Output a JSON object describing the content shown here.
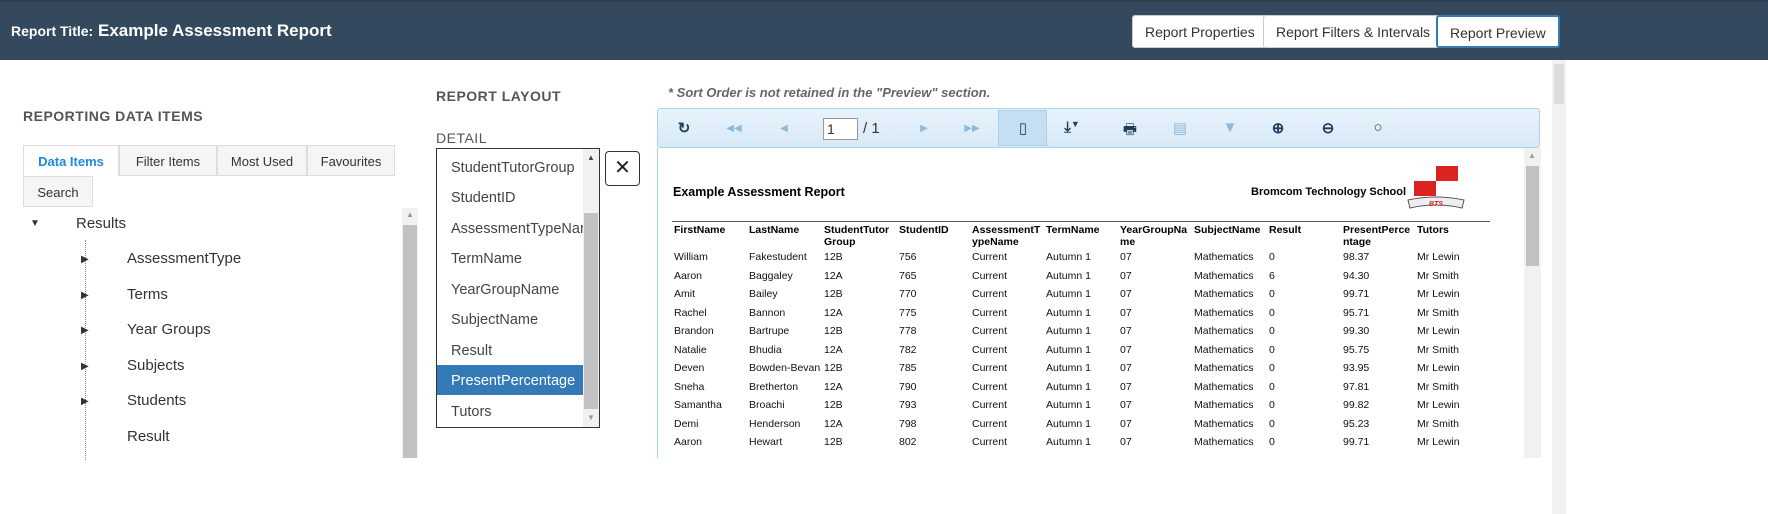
{
  "header": {
    "label": "Report Title:",
    "title": "Example Assessment Report",
    "buttons": [
      "Report Properties",
      "Report Filters & Intervals",
      "Report Preview"
    ]
  },
  "left": {
    "heading": "REPORTING DATA ITEMS",
    "tabs": [
      "Data Items",
      "Filter Items",
      "Most Used",
      "Favourites",
      "Search"
    ],
    "tree": {
      "root": "Results",
      "children": [
        "AssessmentType",
        "Terms",
        "Year Groups",
        "Subjects",
        "Students",
        "Result"
      ]
    }
  },
  "layout": {
    "heading": "REPORT LAYOUT",
    "detail": "DETAIL",
    "items": [
      "StudentTutorGroup",
      "StudentID",
      "AssessmentTypeName",
      "TermName",
      "YearGroupName",
      "SubjectName",
      "Result",
      "PresentPercentage",
      "Tutors"
    ],
    "selected": "PresentPercentage",
    "remove": "✕"
  },
  "preview": {
    "note": "* Sort Order is not retained in the \"Preview\" section.",
    "page": "1",
    "page_total": "/ 1",
    "toolbar_icons": [
      "refresh-icon",
      "first-page-icon",
      "prev-page-icon",
      "next-page-icon",
      "last-page-icon",
      "page-view-icon",
      "export-icon",
      "print-icon",
      "document-map-icon",
      "filter-icon",
      "zoom-in-icon",
      "zoom-out-icon",
      "zoom-icon"
    ]
  },
  "report": {
    "title": "Example Assessment Report",
    "school": "Bromcom Technology School",
    "logo_text": "BTS",
    "columns": [
      "FirstName",
      "LastName",
      "StudentTutor Group",
      "StudentID",
      "AssessmentT ypeName",
      "TermName",
      "YearGroupNa me",
      "SubjectName",
      "Result",
      "PresentPerce ntage",
      "Tutors"
    ],
    "rows": [
      [
        "William",
        "Fakestudent",
        "12B",
        "756",
        "Current",
        "Autumn 1",
        "07",
        "Mathematics",
        "0",
        "98.37",
        "Mr Lewin"
      ],
      [
        "Aaron",
        "Baggaley",
        "12A",
        "765",
        "Current",
        "Autumn 1",
        "07",
        "Mathematics",
        "6",
        "94.30",
        "Mr Smith"
      ],
      [
        "Amit",
        "Bailey",
        "12B",
        "770",
        "Current",
        "Autumn 1",
        "07",
        "Mathematics",
        "0",
        "99.71",
        "Mr Lewin"
      ],
      [
        "Rachel",
        "Bannon",
        "12A",
        "775",
        "Current",
        "Autumn 1",
        "07",
        "Mathematics",
        "0",
        "95.71",
        "Mr Smith"
      ],
      [
        "Brandon",
        "Bartrupe",
        "12B",
        "778",
        "Current",
        "Autumn 1",
        "07",
        "Mathematics",
        "0",
        "99.30",
        "Mr Lewin"
      ],
      [
        "Natalie",
        "Bhudia",
        "12A",
        "782",
        "Current",
        "Autumn 1",
        "07",
        "Mathematics",
        "0",
        "95.75",
        "Mr Smith"
      ],
      [
        "Deven",
        "Bowden-Bevan",
        "12B",
        "785",
        "Current",
        "Autumn 1",
        "07",
        "Mathematics",
        "0",
        "93.95",
        "Mr Lewin"
      ],
      [
        "Sneha",
        "Bretherton",
        "12A",
        "790",
        "Current",
        "Autumn 1",
        "07",
        "Mathematics",
        "0",
        "97.81",
        "Mr Smith"
      ],
      [
        "Samantha",
        "Broachi",
        "12B",
        "793",
        "Current",
        "Autumn 1",
        "07",
        "Mathematics",
        "0",
        "99.82",
        "Mr Lewin"
      ],
      [
        "Demi",
        "Henderson",
        "12A",
        "798",
        "Current",
        "Autumn 1",
        "07",
        "Mathematics",
        "0",
        "95.23",
        "Mr Smith"
      ],
      [
        "Aaron",
        "Hewart",
        "12B",
        "802",
        "Current",
        "Autumn 1",
        "07",
        "Mathematics",
        "0",
        "99.71",
        "Mr Lewin"
      ]
    ]
  }
}
